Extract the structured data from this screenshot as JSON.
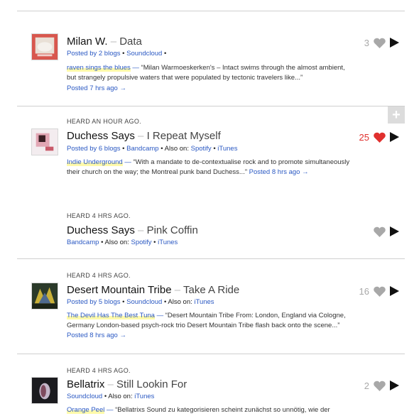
{
  "tracks": [
    {
      "heard": "",
      "artist": "Milan W.",
      "song": "Data",
      "posted_by": "Posted by 2 blogs",
      "sources": [
        "Soundcloud"
      ],
      "also_on": [],
      "blog": "raven sings the blues",
      "description": "“Milan Warmoeskerken's – Intact swims through the almost ambient, but strangely propulsive waters that were populated by tectonic travelers like...”",
      "posted_ago": "Posted 7 hrs ago →",
      "count": "3",
      "loved": false
    },
    {
      "heard": "HEARD AN HOUR AGO.",
      "artist": "Duchess Says",
      "song": "I Repeat Myself",
      "posted_by": "Posted by 6 blogs",
      "sources": [
        "Bandcamp"
      ],
      "also_on_label": "Also on:",
      "also_on": [
        "Spotify",
        "iTunes"
      ],
      "blog": "Indie Underground",
      "description": "“With a mandate to de-contextualise rock and to promote simultaneously their church on the way; the Montreal punk band Duchess...”",
      "posted_ago": "Posted 8 hrs ago →",
      "count": "25",
      "loved": true
    },
    {
      "heard": "HEARD 4 HRS AGO.",
      "artist": "Duchess Says",
      "song": "Pink Coffin",
      "sources": [
        "Bandcamp"
      ],
      "also_on_label": "Also on:",
      "also_on": [
        "Spotify",
        "iTunes"
      ],
      "count": "",
      "loved": false
    },
    {
      "heard": "HEARD 4 HRS AGO.",
      "artist": "Desert Mountain Tribe",
      "song": "Take A Ride",
      "posted_by": "Posted by 5 blogs",
      "sources": [
        "Soundcloud"
      ],
      "also_on_label": "Also on:",
      "also_on": [
        "iTunes"
      ],
      "blog": "The Devil Has The Best Tuna",
      "description": "“Desert Mountain Tribe From: London, England via Cologne, Germany London-based psych-rock trio Desert Mountain Tribe flash back onto the scene...”",
      "posted_ago": "Posted 8 hrs ago →",
      "count": "16",
      "loved": false
    },
    {
      "heard": "HEARD 4 HRS AGO.",
      "artist": "Bellatrix",
      "song": "Still Lookin For",
      "sources": [
        "Soundcloud"
      ],
      "also_on_label": "Also on:",
      "also_on": [
        "iTunes"
      ],
      "blog": "Orange Peel",
      "description": "“Bellatrixs Sound zu kategorisieren scheint zunächst so unnötig, wie der",
      "count": "2",
      "loved": false
    }
  ],
  "separators": {
    "dot": "•",
    "dash": "–",
    "blog_mark": "—"
  },
  "icons": {
    "heart": "heart-icon",
    "play": "play-icon",
    "plus": "plus-icon"
  },
  "colors": {
    "link": "#2b59c3",
    "loved": "#e0302e",
    "neutral_heart": "#a8a8a8"
  }
}
